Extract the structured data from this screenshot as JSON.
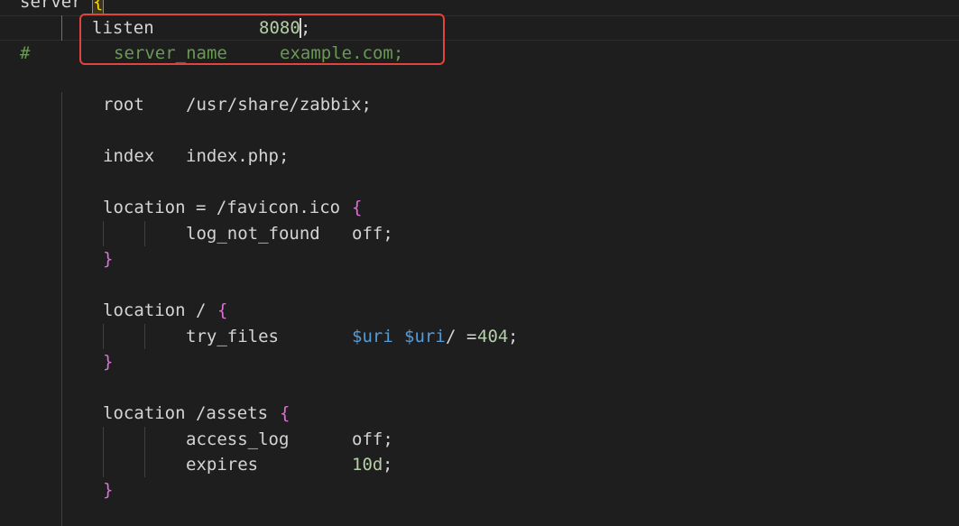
{
  "editor": {
    "language": "nginx",
    "lines": {
      "server": {
        "keyword": "server",
        "brace": "{"
      },
      "listen": {
        "directive": "listen",
        "value": "8080",
        "end": ";"
      },
      "server_name": {
        "hash": "#",
        "directive": "server_name",
        "value": "example.com;"
      },
      "root": {
        "directive": "root",
        "value": "/usr/share/zabbix;"
      },
      "index": {
        "directive": "index",
        "value": "index.php;"
      },
      "loc_favicon": {
        "head": "location = /favicon.ico",
        "brace": "{"
      },
      "log_not_found": {
        "directive": "log_not_found",
        "value": "off;"
      },
      "loc_favicon_close": {
        "brace": "}"
      },
      "loc_root": {
        "head": "location /",
        "brace": "{"
      },
      "try_files": {
        "directive": "try_files",
        "var1": "$uri",
        "var2": "$uri",
        "slash": "/",
        "eq": "=",
        "num": "404",
        "end": ";"
      },
      "loc_root_close": {
        "brace": "}"
      },
      "loc_assets": {
        "head": "location /assets",
        "brace": "{"
      },
      "access_log": {
        "directive": "access_log",
        "value": "off;"
      },
      "expires": {
        "directive": "expires",
        "num": "10d",
        "end": ";"
      },
      "loc_assets_close": {
        "brace": "}"
      }
    }
  },
  "colors": {
    "background": "#1e1e1e",
    "text": "#d4d4d4",
    "comment": "#6a9955",
    "number": "#b5cea8",
    "variable": "#569cd6",
    "brace_level1": "#ffd700",
    "brace_level2": "#da70d6",
    "annotation_box": "#e0443e"
  }
}
